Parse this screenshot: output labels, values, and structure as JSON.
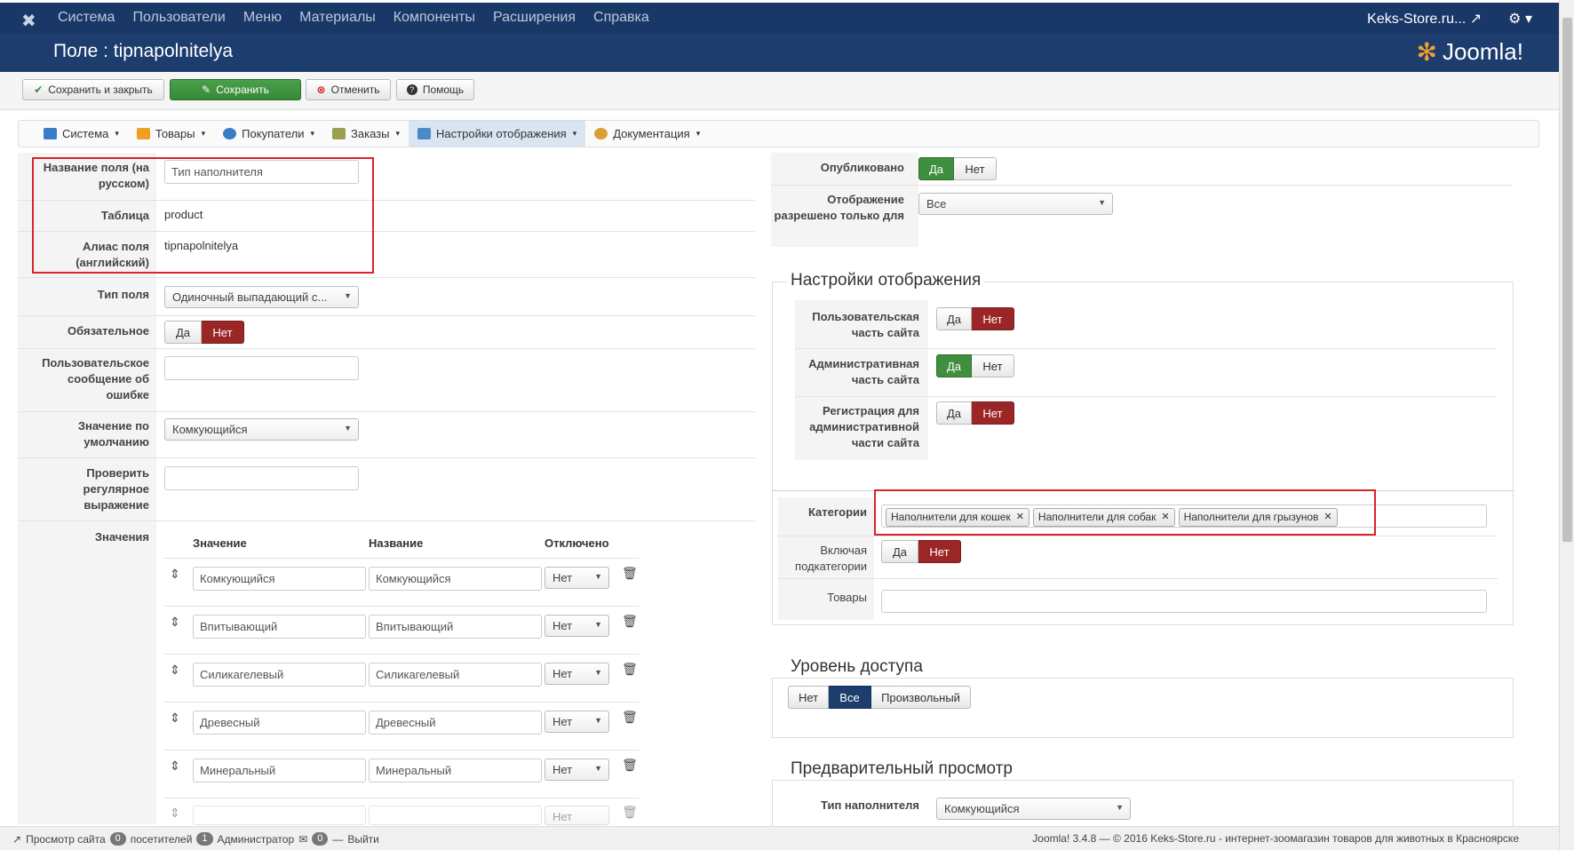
{
  "topnav": {
    "menu": [
      "Система",
      "Пользователи",
      "Меню",
      "Материалы",
      "Компоненты",
      "Расширения",
      "Справка"
    ],
    "site_link": "Keks-Store.ru...",
    "settings_icon": "gear-icon"
  },
  "header": {
    "title": "Поле : tipnapolnitelya",
    "brand": "Joomla!"
  },
  "toolbar": {
    "save_close": "Сохранить и закрыть",
    "save": "Сохранить",
    "cancel": "Отменить",
    "help": "Помощь"
  },
  "submenu": [
    {
      "label": "Система",
      "icon": "tools-icon",
      "color": "#3a7cc7"
    },
    {
      "label": "Товары",
      "icon": "box-icon",
      "color": "#f0a020"
    },
    {
      "label": "Покупатели",
      "icon": "users-icon",
      "color": "#3a7cc7"
    },
    {
      "label": "Заказы",
      "icon": "orders-icon",
      "color": "#9aa050"
    },
    {
      "label": "Настройки отображения",
      "icon": "display-icon",
      "color": "#4a8ac7"
    },
    {
      "label": "Документация",
      "icon": "docs-icon",
      "color": "#d8a030"
    }
  ],
  "left_form": {
    "name_label": "Название поля (на русском)",
    "name_value": "Тип наполнителя",
    "table_label": "Таблица",
    "table_value": "product",
    "alias_label": "Алиас поля (английский)",
    "alias_value": "tipnapolnitelya",
    "type_label": "Тип поля",
    "type_value": "Одиночный выпадающий с...",
    "required_label": "Обязательное",
    "yes": "Да",
    "no": "Нет",
    "error_label": "Пользовательское сообщение об ошибке",
    "default_label": "Значение по умолчанию",
    "default_value": "Комкующийся",
    "regex_label": "Проверить регулярное выражение",
    "values_label": "Значения",
    "col_value": "Значение",
    "col_name": "Название",
    "col_disabled": "Отключено",
    "rows": [
      {
        "value": "Комкующийся",
        "name": "Комкующийся",
        "disabled": "Нет"
      },
      {
        "value": "Впитывающий",
        "name": "Впитывающий",
        "disabled": "Нет"
      },
      {
        "value": "Силикагелевый",
        "name": "Силикагелевый",
        "disabled": "Нет"
      },
      {
        "value": "Древесный",
        "name": "Древесный",
        "disabled": "Нет"
      },
      {
        "value": "Минеральный",
        "name": "Минеральный",
        "disabled": "Нет"
      },
      {
        "value": "",
        "name": "",
        "disabled": "Нет"
      }
    ]
  },
  "right_form": {
    "published_label": "Опубликовано",
    "yes": "Да",
    "no": "Нет",
    "visible_for_label": "Отображение разрешено только для",
    "visible_for_value": "Все",
    "display_legend": "Настройки отображения",
    "frontend_label": "Пользовательская часть сайта",
    "admin_label": "Административная часть сайта",
    "reg_label": "Регистрация для административной части сайта",
    "categories_label": "Категории",
    "categories": [
      "Наполнители для кошек",
      "Наполнители для собак",
      "Наполнители для грызунов"
    ],
    "subcats_label": "Включая подкатегории",
    "products_label": "Товары",
    "access_legend": "Уровень доступа",
    "access_none": "Нет",
    "access_all": "Все",
    "access_custom": "Произвольный",
    "preview_legend": "Предварительный просмотр",
    "preview_label": "Тип наполнителя",
    "preview_value": "Комкующийся"
  },
  "footer": {
    "view_site": "Просмотр сайта",
    "visitors_count": "0",
    "visitors": "посетителей",
    "admins_count": "1",
    "admins": "Администратор",
    "messages_count": "0",
    "logout": "Выйти",
    "copyright": "Joomla! 3.4.8 — © 2016 Keks-Store.ru - интернет-зоомагазин товаров для животных в Красноярске"
  }
}
